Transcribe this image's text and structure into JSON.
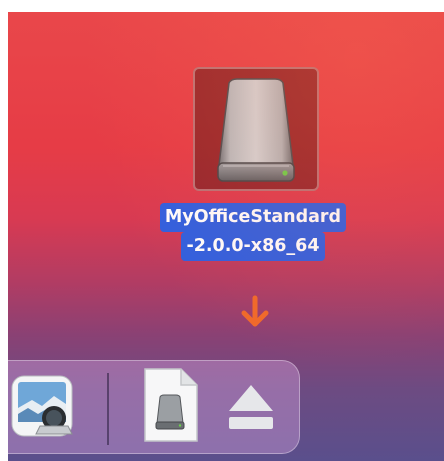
{
  "desktop": {
    "drive_icon": "external-drive-icon",
    "drive_label_line1": "MyOfficeStandard",
    "drive_label_line2": "-2.0.0-x86_64",
    "selection_color": "#2f5fe0"
  },
  "hint_arrow": {
    "icon": "down-arrow-icon",
    "color": "#f06a2a"
  },
  "dock": {
    "items": [
      {
        "name": "Preview",
        "icon": "preview-app-icon"
      },
      {
        "name": "Disk image",
        "icon": "disk-image-file-icon"
      },
      {
        "name": "Eject",
        "icon": "eject-icon"
      }
    ]
  }
}
